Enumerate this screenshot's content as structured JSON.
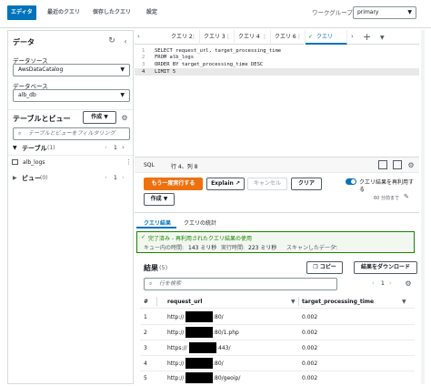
{
  "topbar": {
    "tabs": [
      "エディタ",
      "最近のクエリ",
      "保存したクエリ",
      "設定"
    ],
    "workgroup_label": "ワークグループ",
    "workgroup_value": "primary"
  },
  "left": {
    "data_title": "データ",
    "datasource_label": "データソース",
    "datasource_value": "AwsDataCatalog",
    "database_label": "データベース",
    "database_value": "alb_db",
    "tables_views_title": "テーブルとビュー",
    "create_label": "作成 ▼",
    "filter_placeholder": "テーブルとビューをフィルタリング",
    "tables_label": "テーブル",
    "tables_count": "(1)",
    "page": "1",
    "table_item": "alb_logs",
    "views_label": "ビュー",
    "views_count": "(0)"
  },
  "editor": {
    "tabs": [
      "クエリ 2",
      "クエリ 3",
      "クエリ 4",
      "クエリ 6",
      "クエリ"
    ],
    "lines": [
      "SELECT request_url, target_processing_time",
      "FROM alb_logs",
      "ORDER BY target_processing_time DESC",
      "LIMIT 5"
    ],
    "line_numbers": [
      "1",
      "2",
      "3",
      "4"
    ],
    "status_lang": "SQL",
    "status_pos": "行 4、列 8"
  },
  "actions": {
    "rerun": "もう一度実行する",
    "explain": "Explain",
    "cancel": "キャンセル",
    "clear": "クリア",
    "create": "作成 ▼",
    "reuse_label": "クエリ結果を再利用す",
    "reuse_sub": "る",
    "reuse_time": "60 分前まで"
  },
  "results": {
    "tab_results": "クエリ結果",
    "tab_stats": "クエリの統計",
    "status_title": "完了済み - 再利用されたクエリ結果の使用",
    "queue_time_label": "キュー内の時間:",
    "queue_time": "143 ミリ秒",
    "exec_time_label": "実行時間:",
    "exec_time": "223 ミリ秒",
    "scanned_label": "スキャンしたデータ:",
    "scanned": "-",
    "title": "結果",
    "count": "(5)",
    "copy": "コピー",
    "download": "結果をダウンロード",
    "search_placeholder": "行を検索",
    "page": "1",
    "columns": [
      "#",
      "request_url",
      "target_processing_time"
    ],
    "rows": [
      {
        "n": "1",
        "url_prefix": "http://",
        "url_suffix": ":80/",
        "time": "0.002"
      },
      {
        "n": "2",
        "url_prefix": "http://",
        "url_suffix": ":80/1.php",
        "time": "0.002"
      },
      {
        "n": "3",
        "url_prefix": "https://",
        "url_suffix": ":443/",
        "time": "0.002"
      },
      {
        "n": "4",
        "url_prefix": "http://",
        "url_suffix": ":80/",
        "time": "0.002"
      },
      {
        "n": "5",
        "url_prefix": "http://",
        "url_suffix": ":80/geoip/",
        "time": "0.002"
      }
    ]
  },
  "colors": {
    "primary": "#0073bb",
    "orange": "#ec7211",
    "success": "#1d8102"
  }
}
